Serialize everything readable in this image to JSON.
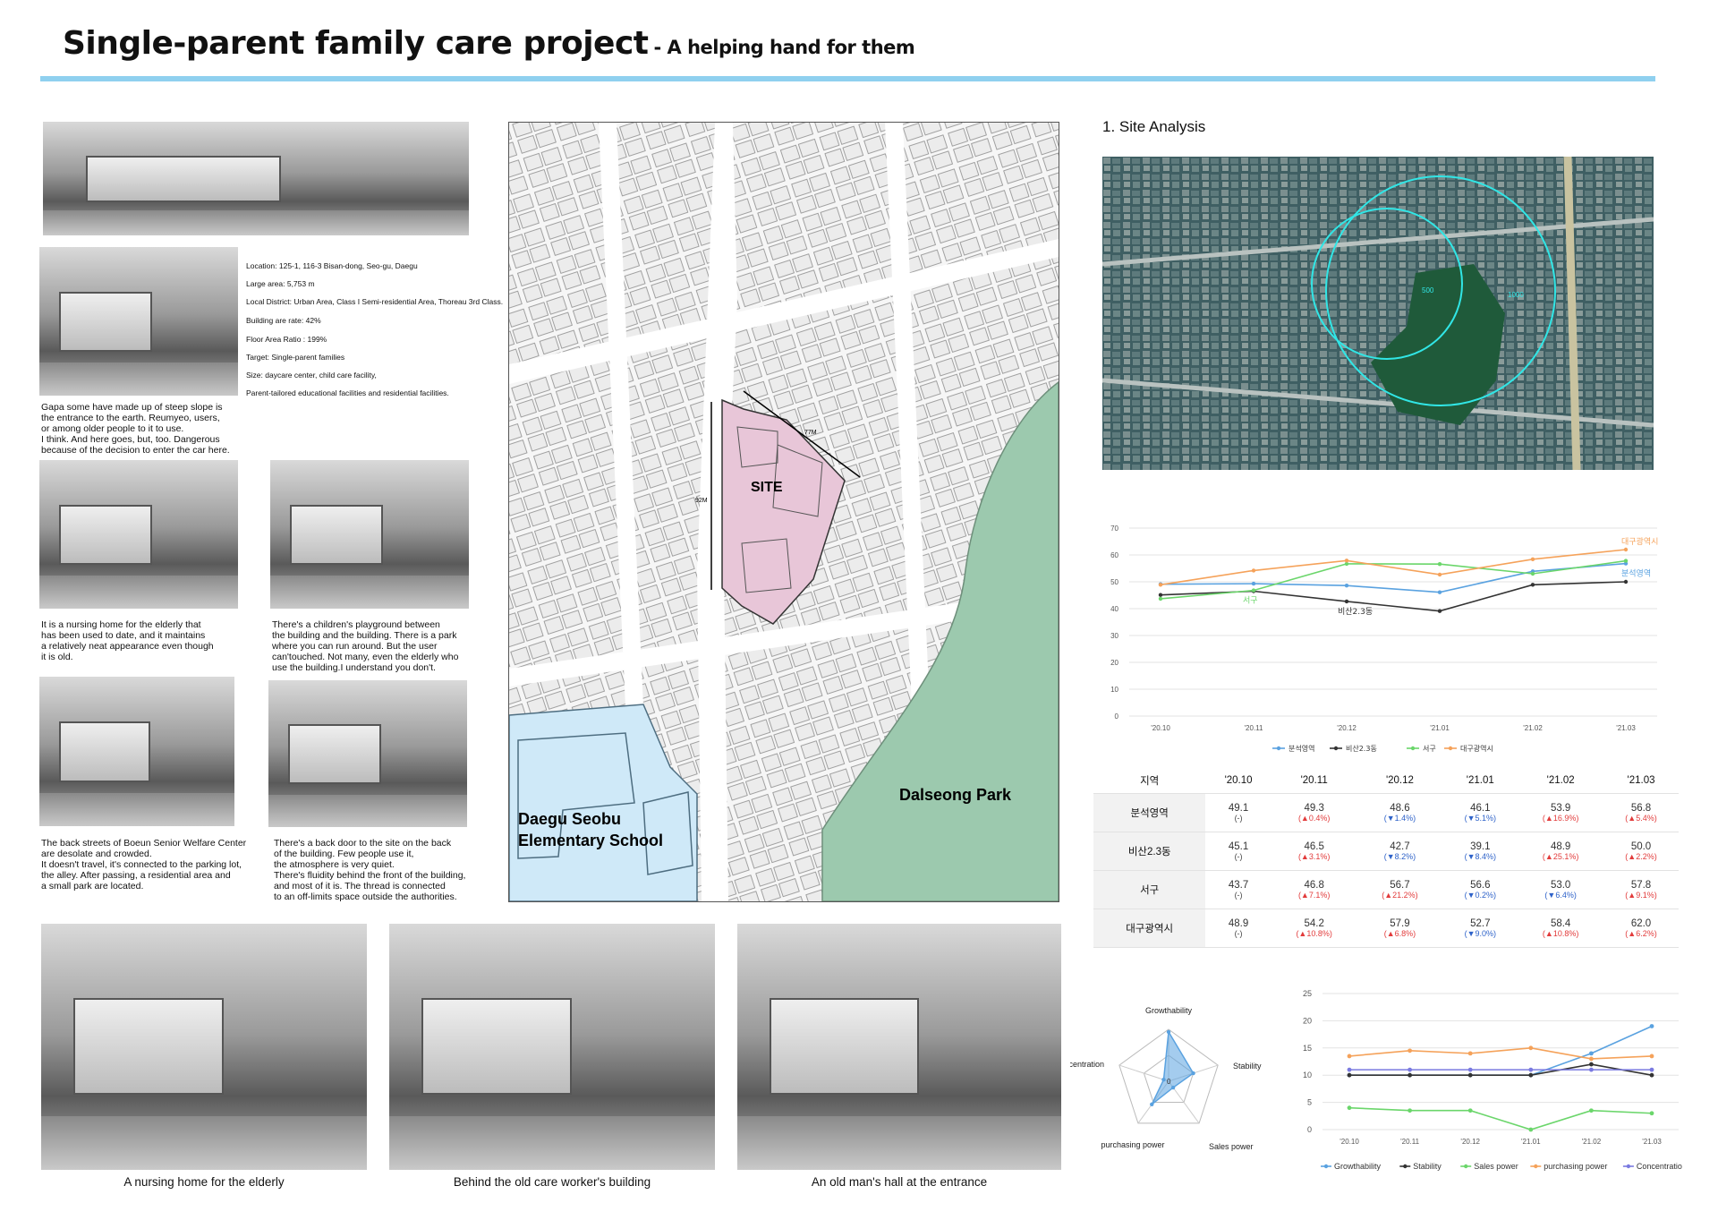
{
  "header": {
    "title": "Single-parent family care project",
    "subtitle": "- A helping hand for them"
  },
  "site_info": [
    "Location: 125-1, 116-3 Bisan-dong, Seo-gu, Daegu",
    "Large area: 5,753 m",
    "Local District: Urban Area, Class I Semi-residential Area, Thoreau 3rd Class.",
    "Building are rate: 42%",
    "Floor Area Ratio : 199%",
    "Target: Single-parent families",
    "Size: daycare center, child care facility,",
    "Parent-tailored educational facilities and residential facilities."
  ],
  "captions": {
    "slope": "Gapa some have made up of steep slope is\nthe entrance to the earth. Reumyeo, users,\nor among older people to it to use.\nI think. And here goes, but, too. Dangerous\nbecause of the decision to enter the car here.",
    "nursing": "It is a nursing home for the elderly that\nhas been used to date, and it maintains\na relatively neat appearance even though\nit is old.",
    "playground": "There's a children's playground between\nthe building and the building. There is a park\nwhere you can run around. But the user\ncan'touched. Not many, even the elderly who\nuse the building.I understand you don't.",
    "backstreet": "The back streets of Boeun Senior Welfare Center\nare desolate and crowded.\nIt doesn't travel, it's connected to the parking lot,\nthe alley. After passing, a residential area and\na small park are located.",
    "backdoor": "There's a back door to the site on the back\nof the building. Few people use it,\nthe atmosphere is very quiet.\nThere's fluidity behind the front of the building,\nand most of it is. The thread is connected\nto an off-limits space outside the authorities.",
    "bottom1": "A nursing home for the elderly",
    "bottom2": "Behind the old care worker's building",
    "bottom3": "An old man's hall at the entrance"
  },
  "map": {
    "site_label": "SITE",
    "dim_top": "77M",
    "dim_left": "92M",
    "park_label": "Dalseong Park",
    "school_label_1": "Daegu Seobu",
    "school_label_2": "Elementary School"
  },
  "analysis": {
    "section_title": "1. Site Analysis",
    "aerial_labels": [
      "500",
      "1000"
    ]
  },
  "chart_data": [
    {
      "type": "line",
      "x": [
        "'20.10",
        "'20.11",
        "'20.12",
        "'21.01",
        "'21.02",
        "'21.03"
      ],
      "ylim": [
        0,
        70
      ],
      "yticks": [
        0,
        10,
        20,
        30,
        40,
        50,
        60,
        70
      ],
      "series": [
        {
          "name": "분석영역",
          "values": [
            49.1,
            49.3,
            48.6,
            46.1,
            53.9,
            56.8
          ],
          "color": "#5aa2e0"
        },
        {
          "name": "비산2.3동",
          "values": [
            45.1,
            46.5,
            42.7,
            39.1,
            48.9,
            50.0
          ],
          "color": "#333333"
        },
        {
          "name": "서구",
          "values": [
            43.7,
            46.8,
            56.7,
            56.6,
            53.0,
            57.8
          ],
          "color": "#6bd66b"
        },
        {
          "name": "대구광역시",
          "values": [
            48.9,
            54.2,
            57.9,
            52.7,
            58.4,
            62.0
          ],
          "color": "#f5a25a"
        }
      ],
      "annotations": [
        "대구광역시",
        "분석영역",
        "서구",
        "비산2.3동"
      ],
      "legend": "bottom",
      "grid": true
    },
    {
      "type": "table",
      "columns": [
        "지역",
        "'20.10",
        "'20.11",
        "'20.12",
        "'21.01",
        "'21.02",
        "'21.03"
      ],
      "rows": [
        {
          "label": "분석영역",
          "cells": [
            [
              "49.1",
              "(-)",
              ""
            ],
            [
              "49.3",
              "(▲0.4%)",
              "up"
            ],
            [
              "48.6",
              "(▼1.4%)",
              "dn"
            ],
            [
              "46.1",
              "(▼5.1%)",
              "dn"
            ],
            [
              "53.9",
              "(▲16.9%)",
              "up"
            ],
            [
              "56.8",
              "(▲5.4%)",
              "up"
            ]
          ]
        },
        {
          "label": "비산2.3동",
          "cells": [
            [
              "45.1",
              "(-)",
              ""
            ],
            [
              "46.5",
              "(▲3.1%)",
              "up"
            ],
            [
              "42.7",
              "(▼8.2%)",
              "dn"
            ],
            [
              "39.1",
              "(▼8.4%)",
              "dn"
            ],
            [
              "48.9",
              "(▲25.1%)",
              "up"
            ],
            [
              "50.0",
              "(▲2.2%)",
              "up"
            ]
          ]
        },
        {
          "label": "서구",
          "cells": [
            [
              "43.7",
              "(-)",
              ""
            ],
            [
              "46.8",
              "(▲7.1%)",
              "up"
            ],
            [
              "56.7",
              "(▲21.2%)",
              "up"
            ],
            [
              "56.6",
              "(▼0.2%)",
              "dn"
            ],
            [
              "53.0",
              "(▼6.4%)",
              "dn"
            ],
            [
              "57.8",
              "(▲9.1%)",
              "up"
            ]
          ]
        },
        {
          "label": "대구광역시",
          "cells": [
            [
              "48.9",
              "(-)",
              ""
            ],
            [
              "54.2",
              "(▲10.8%)",
              "up"
            ],
            [
              "57.9",
              "(▲6.8%)",
              "up"
            ],
            [
              "52.7",
              "(▼9.0%)",
              "dn"
            ],
            [
              "58.4",
              "(▲10.8%)",
              "up"
            ],
            [
              "62.0",
              "(▲6.2%)",
              "up"
            ]
          ]
        }
      ]
    },
    {
      "type": "radar",
      "axes": [
        "Growthability",
        "Stability",
        "Sales power",
        "purchasing power",
        "Concentration"
      ],
      "values": [
        19,
        10,
        3,
        11,
        2
      ],
      "max": 20,
      "center_label": "0",
      "color": "#5aa2e0"
    },
    {
      "type": "line",
      "x": [
        "'20.10",
        "'20.11",
        "'20.12",
        "'21.01",
        "'21.02",
        "'21.03"
      ],
      "ylim": [
        0,
        25
      ],
      "yticks": [
        0,
        5,
        10,
        15,
        20,
        25
      ],
      "series": [
        {
          "name": "Growthability",
          "values": [
            10,
            10,
            10,
            10,
            14,
            19
          ],
          "color": "#5aa2e0"
        },
        {
          "name": "Stability",
          "values": [
            10,
            10,
            10,
            10,
            12,
            10
          ],
          "color": "#333333"
        },
        {
          "name": "Sales power",
          "values": [
            4,
            3.5,
            3.5,
            0,
            3.5,
            3
          ],
          "color": "#6bd66b"
        },
        {
          "name": "purchasing power",
          "values": [
            13.5,
            14.5,
            14,
            15,
            13,
            13.5
          ],
          "color": "#f5a25a"
        },
        {
          "name": "Concentration",
          "values": [
            11,
            11,
            11,
            11,
            11,
            11
          ],
          "color": "#7a7ae0"
        }
      ],
      "legend": "bottom",
      "grid": true
    }
  ]
}
